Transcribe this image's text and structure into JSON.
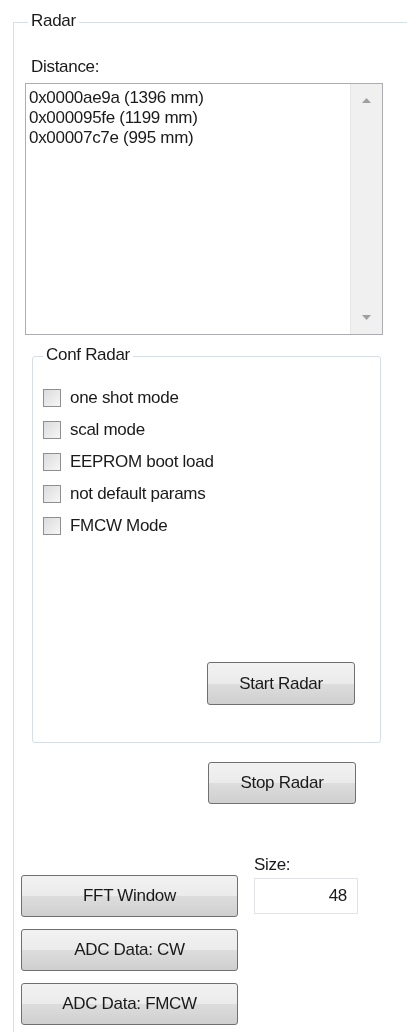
{
  "group": {
    "title": "Radar"
  },
  "distance": {
    "label": "Distance:",
    "items": [
      "0x0000ae9a (1396 mm)",
      "0x000095fe (1199 mm)",
      "0x00007c7e (995 mm)"
    ]
  },
  "conf": {
    "title": "Conf Radar",
    "options": [
      {
        "label": "one shot mode",
        "checked": false
      },
      {
        "label": "scal mode",
        "checked": false
      },
      {
        "label": "EEPROM boot load",
        "checked": false
      },
      {
        "label": "not default params",
        "checked": false
      },
      {
        "label": "FMCW Mode",
        "checked": false
      }
    ],
    "start_button": "Start Radar"
  },
  "stop_button": "Stop Radar",
  "fft": {
    "button": "FFT Window",
    "size_label": "Size:",
    "size_value": "48"
  },
  "adc_buttons": [
    "ADC Data: CW",
    "ADC Data: FMCW"
  ]
}
